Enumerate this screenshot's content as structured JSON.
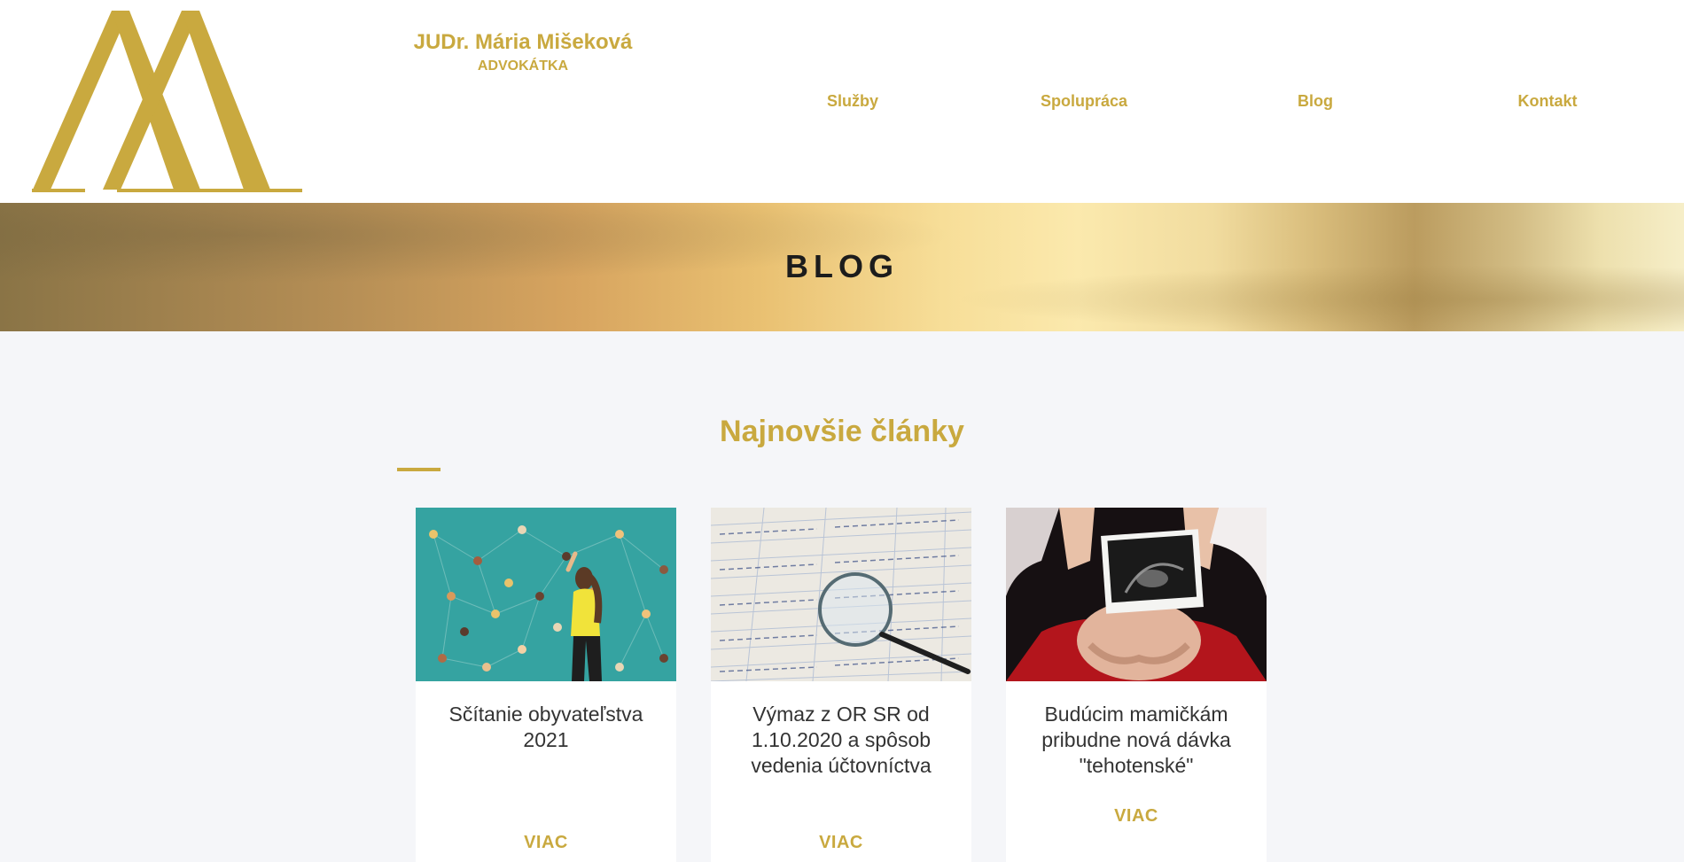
{
  "brand": {
    "name": "JUDr. Mária Mišeková",
    "subtitle": "ADVOKÁTKA"
  },
  "nav": [
    {
      "label": "Služby"
    },
    {
      "label": "Spolupráca"
    },
    {
      "label": "Blog"
    },
    {
      "label": "Kontakt"
    }
  ],
  "banner": {
    "title": "BLOG"
  },
  "section": {
    "title": "Najnovšie články"
  },
  "articles": [
    {
      "title": "Sčítanie obyvateľstva 2021",
      "more": "VIAC",
      "image_icon": "census-network-illustration"
    },
    {
      "title": "Výmaz z OR SR od 1.10.2020 a spôsob vedenia účtovníctva",
      "more": "VIAC",
      "image_icon": "ledger-magnifier-photo"
    },
    {
      "title": "Budúcim mamičkám pribudne nová dávka \"tehotenské\"",
      "more": "VIAC",
      "image_icon": "pregnancy-ultrasound-photo"
    }
  ],
  "colors": {
    "accent": "#c9a93f",
    "background": "#f5f6f9",
    "text": "#333333"
  }
}
